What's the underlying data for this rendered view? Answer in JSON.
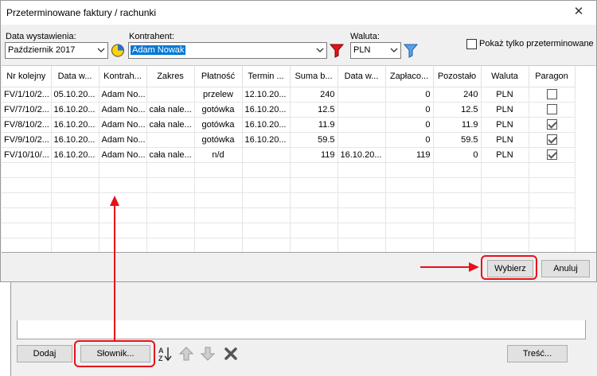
{
  "window": {
    "title": "Przeterminowane faktury / rachunki",
    "close_glyph": "✕"
  },
  "filters": {
    "date_label": "Data wystawienia:",
    "date_value": "Październik 2017",
    "contractor_label": "Kontrahent:",
    "contractor_value": "Adam Nowak",
    "currency_label": "Waluta:",
    "currency_value": "PLN",
    "overdue_only_label": "Pokaż tylko przeterminowane"
  },
  "table": {
    "columns": [
      "Nr kolejny",
      "Data w...",
      "Kontrah...",
      "Zakres",
      "Płatność",
      "Termin ...",
      "Suma b...",
      "Data w...",
      "Zapłaco...",
      "Pozostało",
      "Waluta",
      "Paragon"
    ],
    "rows": [
      {
        "nr": "FV/1/10/2...",
        "data_w": "05.10.20...",
        "kontrahent": "Adam No...",
        "zakres": "",
        "platnosc": "przelew",
        "termin": "12.10.20...",
        "suma": "240",
        "data_wplaty": "",
        "zaplacono": "0",
        "pozostalo": "240",
        "waluta": "PLN",
        "paragon": false
      },
      {
        "nr": "FV/7/10/2...",
        "data_w": "16.10.20...",
        "kontrahent": "Adam No...",
        "zakres": "cała nale...",
        "platnosc": "gotówka",
        "termin": "16.10.20...",
        "suma": "12.5",
        "data_wplaty": "",
        "zaplacono": "0",
        "pozostalo": "12.5",
        "waluta": "PLN",
        "paragon": false
      },
      {
        "nr": "FV/8/10/2...",
        "data_w": "16.10.20...",
        "kontrahent": "Adam No...",
        "zakres": "cała nale...",
        "platnosc": "gotówka",
        "termin": "16.10.20...",
        "suma": "11.9",
        "data_wplaty": "",
        "zaplacono": "0",
        "pozostalo": "11.9",
        "waluta": "PLN",
        "paragon": true
      },
      {
        "nr": "FV/9/10/2...",
        "data_w": "16.10.20...",
        "kontrahent": "Adam No...",
        "zakres": "",
        "platnosc": "gotówka",
        "termin": "16.10.20...",
        "suma": "59.5",
        "data_wplaty": "",
        "zaplacono": "0",
        "pozostalo": "59.5",
        "waluta": "PLN",
        "paragon": true
      },
      {
        "nr": "FV/10/10/...",
        "data_w": "16.10.20...",
        "kontrahent": "Adam No...",
        "zakres": "cała nale...",
        "platnosc": "n/d",
        "termin": "",
        "suma": "119",
        "data_wplaty": "16.10.20...",
        "zaplacono": "119",
        "pozostalo": "0",
        "waluta": "PLN",
        "paragon": true
      }
    ]
  },
  "dialog_buttons": {
    "select": "Wybierz",
    "cancel": "Anuluj"
  },
  "underlying": {
    "add": "Dodaj",
    "dictionary": "Słownik...",
    "content": "Treść..."
  },
  "colors": {
    "annotation_red": "#e8101a",
    "selection_blue": "#0078d7"
  }
}
